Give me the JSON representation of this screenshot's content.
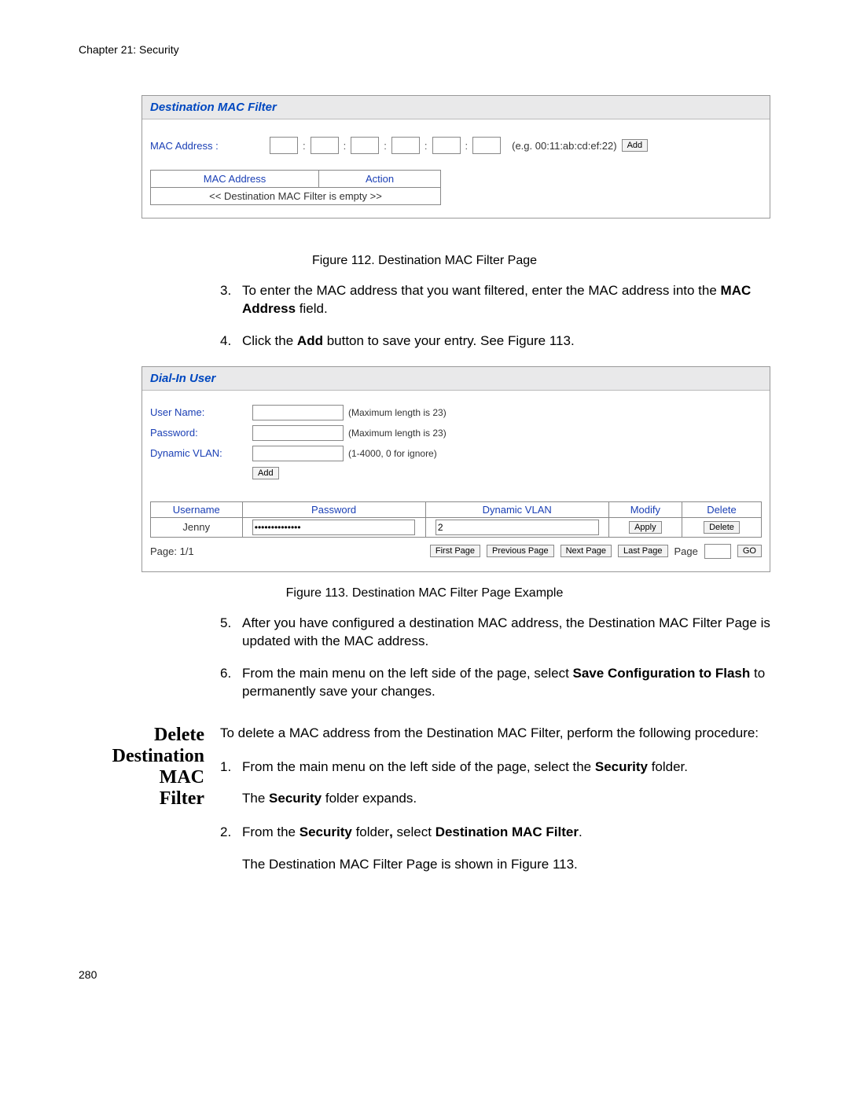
{
  "header": {
    "chapter": "Chapter 21: Security"
  },
  "footer": {
    "page": "280"
  },
  "panel1": {
    "title": "Destination MAC Filter",
    "mac_label": "MAC Address :",
    "example": "(e.g. 00:11:ab:cd:ef:22)",
    "add_label": "Add",
    "table": {
      "col1": "MAC Address",
      "col2": "Action",
      "empty": "<< Destination MAC Filter is empty >>"
    }
  },
  "fig112": "Figure 112. Destination MAC Filter Page",
  "step3": {
    "num": "3.",
    "text_a": "To enter the MAC address that you want filtered, enter the MAC address into the ",
    "text_b": "MAC Address",
    "text_c": " field."
  },
  "step4": {
    "num": "4.",
    "text_a": "Click the ",
    "text_b": "Add",
    "text_c": " button to save your entry. See Figure 113."
  },
  "panel2": {
    "title": "Dial-In User",
    "rows": {
      "username": "User Name:",
      "password": "Password:",
      "vlan": "Dynamic VLAN:"
    },
    "hints": {
      "max23a": "(Maximum length is 23)",
      "max23b": "(Maximum length is 23)",
      "vlan": "(1-4000, 0 for ignore)"
    },
    "add_label": "Add",
    "table": {
      "h_user": "Username",
      "h_pass": "Password",
      "h_vlan": "Dynamic VLAN",
      "h_mod": "Modify",
      "h_del": "Delete",
      "row": {
        "user": "Jenny",
        "pass": "••••••••••••••",
        "vlan": "2",
        "apply": "Apply",
        "delete": "Delete"
      }
    },
    "pager": {
      "page_label": "Page: 1/1",
      "first": "First Page",
      "prev": "Previous Page",
      "next": "Next Page",
      "last": "Last Page",
      "page_word": "Page",
      "go": "GO"
    }
  },
  "fig113": "Figure 113. Destination MAC Filter Page Example",
  "step5": {
    "num": "5.",
    "text": "After you have configured a destination MAC address, the Destination MAC Filter Page is updated with the MAC address."
  },
  "step6": {
    "num": "6.",
    "text_a": "From the main menu on the left side of the page, select ",
    "text_b": "Save Configuration to Flash",
    "text_c": " to permanently save your changes."
  },
  "section2": {
    "heading_l1": "Delete",
    "heading_l2": "Destination MAC",
    "heading_l3": "Filter",
    "intro": "To delete a MAC address from the Destination MAC Filter, perform the following procedure:",
    "step1": {
      "num": "1.",
      "text_a": "From the main menu on the left side of the page, select the ",
      "text_b": "Security",
      "text_c": " folder."
    },
    "after1_a": "The ",
    "after1_b": "Security",
    "after1_c": " folder expands.",
    "step2": {
      "num": "2.",
      "text_a": "From the ",
      "text_b": "Security",
      "text_c": " folder",
      "comma": ", ",
      "text_d": "select ",
      "text_e": "Destination MAC Filter",
      "text_f": "."
    },
    "after2": "The Destination MAC Filter Page is shown in Figure 113."
  }
}
